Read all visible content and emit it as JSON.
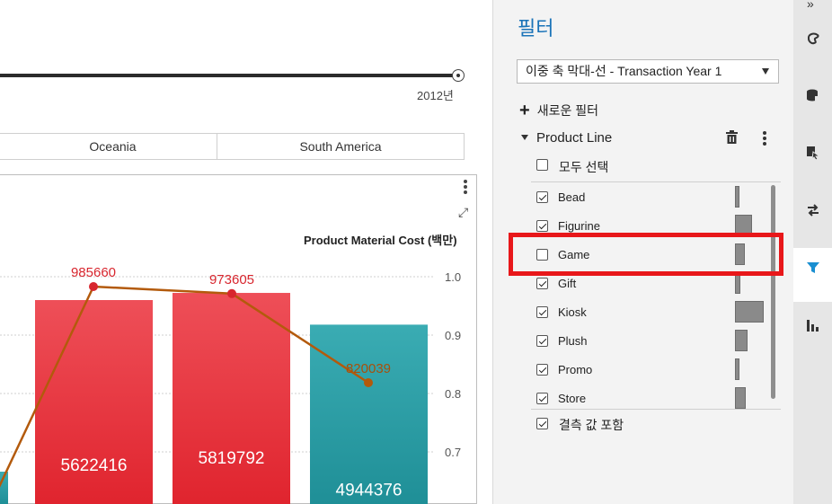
{
  "slider": {
    "year_label": "2012년"
  },
  "segments": [
    "",
    "Oceania",
    "South America"
  ],
  "chart": {
    "axis_title": "Product Material Cost (백만)"
  },
  "chart_data": {
    "type": "bar",
    "categories": [
      "",
      "",
      "",
      ""
    ],
    "series": [
      {
        "type": "bar",
        "values": [
          null,
          5622416,
          5819792,
          4944376
        ],
        "colors": [
          "#2aa3aa",
          "#e2313a",
          "#e2313a",
          "#2aa3aa"
        ]
      },
      {
        "type": "line",
        "values": [
          null,
          985660,
          973605,
          820039
        ],
        "color": "#b35a0c"
      }
    ],
    "y2_ticks": [
      "1.0",
      "0.9",
      "0.8",
      "0.7"
    ],
    "y2lim": [
      0.6,
      1.05
    ],
    "grid": true
  },
  "panel": {
    "title": "필터",
    "select_value": "이중 축 막대-선 - Transaction Year 1",
    "new_filter": "새로운 필터",
    "product_line": "Product Line",
    "select_all": "모두 선택",
    "include_missing": "결측 값 포함",
    "items": [
      {
        "label": "Bead",
        "checked": true,
        "freq": 0.12
      },
      {
        "label": "Figurine",
        "checked": true,
        "freq": 0.6
      },
      {
        "label": "Game",
        "checked": false,
        "freq": 0.35
      },
      {
        "label": "Gift",
        "checked": true,
        "freq": 0.2
      },
      {
        "label": "Kiosk",
        "checked": true,
        "freq": 1.0
      },
      {
        "label": "Plush",
        "checked": true,
        "freq": 0.45
      },
      {
        "label": "Promo",
        "checked": true,
        "freq": 0.15
      },
      {
        "label": "Store",
        "checked": true,
        "freq": 0.38
      }
    ]
  },
  "strip_icons": [
    "collapse-icon",
    "palette-icon",
    "data-icon",
    "pointer-icon",
    "swap-icon",
    "filter-icon",
    "chart-icon"
  ]
}
